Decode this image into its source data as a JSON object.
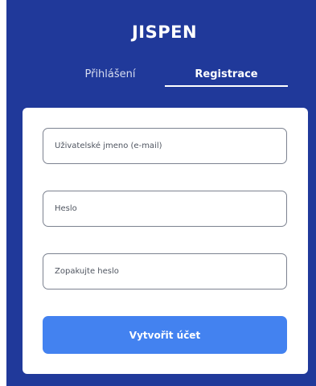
{
  "app": {
    "brand": "JISPEN",
    "tabs": {
      "login": "Přihlášení",
      "register": "Registrace"
    },
    "form": {
      "email_placeholder": "Uživatelské jmeno (e-mail)",
      "password_placeholder": "Heslo",
      "repeat_password_placeholder": "Zopakujte heslo",
      "submit_label": "Vytvořit účet"
    },
    "colors": {
      "background": "#20399a",
      "card": "#ffffff",
      "primary_button": "#4382f0"
    }
  }
}
